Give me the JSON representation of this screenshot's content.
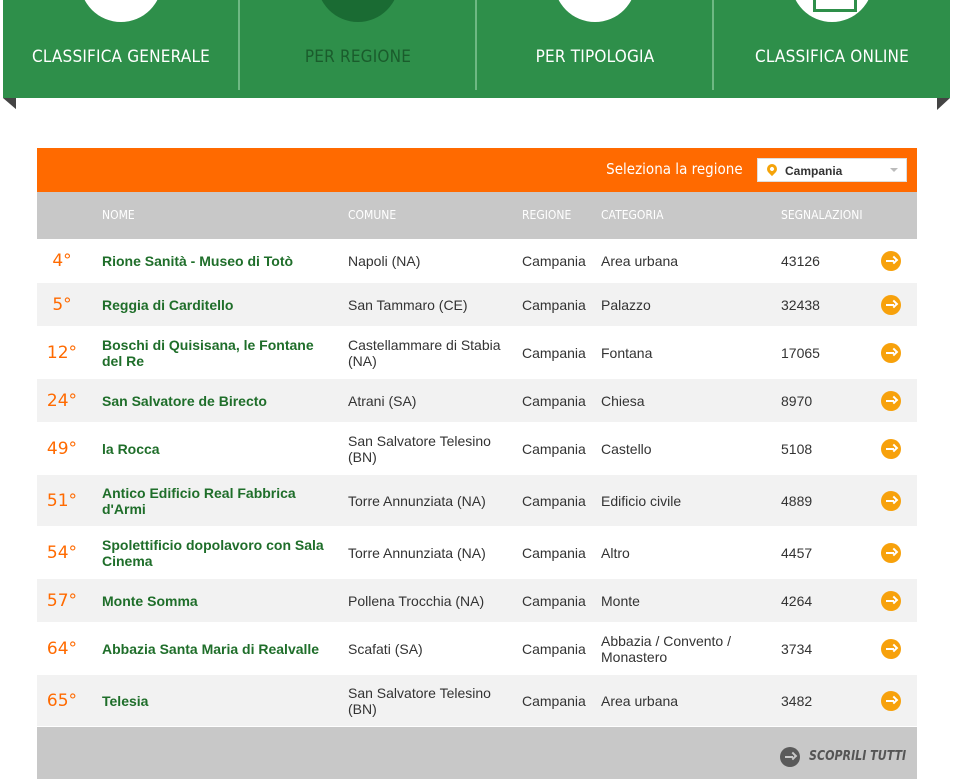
{
  "tabs": [
    {
      "label": "CLASSIFICA GENERALE",
      "active": false
    },
    {
      "label": "PER REGIONE",
      "active": true
    },
    {
      "label": "PER TIPOLOGIA",
      "active": false
    },
    {
      "label": "CLASSIFICA ONLINE",
      "active": false
    }
  ],
  "region_filter": {
    "label": "Seleziona la regione",
    "selected": "Campania",
    "icon": "map-pin-icon"
  },
  "table": {
    "headers": {
      "nome": "NOME",
      "comune": "COMUNE",
      "regione": "REGIONE",
      "categoria": "CATEGORIA",
      "segnalazioni": "SEGNALAZIONI"
    },
    "rows": [
      {
        "rank": "4°",
        "nome": "Rione Sanità - Museo di Totò",
        "comune": "Napoli (NA)",
        "regione": "Campania",
        "categoria": "Area urbana",
        "segnalazioni": "43126"
      },
      {
        "rank": "5°",
        "nome": "Reggia di Carditello",
        "comune": "San Tammaro (CE)",
        "regione": "Campania",
        "categoria": "Palazzo",
        "segnalazioni": "32438"
      },
      {
        "rank": "12°",
        "nome": "Boschi di Quisisana, le Fontane del Re",
        "comune": "Castellammare di Stabia (NA)",
        "regione": "Campania",
        "categoria": "Fontana",
        "segnalazioni": "17065"
      },
      {
        "rank": "24°",
        "nome": "San Salvatore de Birecto",
        "comune": "Atrani (SA)",
        "regione": "Campania",
        "categoria": "Chiesa",
        "segnalazioni": "8970"
      },
      {
        "rank": "49°",
        "nome": "la Rocca",
        "comune": "San Salvatore Telesino (BN)",
        "regione": "Campania",
        "categoria": "Castello",
        "segnalazioni": "5108"
      },
      {
        "rank": "51°",
        "nome": "Antico Edificio Real Fabbrica d'Armi",
        "comune": "Torre Annunziata (NA)",
        "regione": "Campania",
        "categoria": "Edificio civile",
        "segnalazioni": "4889"
      },
      {
        "rank": "54°",
        "nome": "Spolettificio dopolavoro con Sala Cinema",
        "comune": "Torre Annunziata (NA)",
        "regione": "Campania",
        "categoria": "Altro",
        "segnalazioni": "4457"
      },
      {
        "rank": "57°",
        "nome": "Monte Somma",
        "comune": "Pollena Trocchia (NA)",
        "regione": "Campania",
        "categoria": "Monte",
        "segnalazioni": "4264"
      },
      {
        "rank": "64°",
        "nome": "Abbazia Santa Maria di Realvalle",
        "comune": "Scafati (SA)",
        "regione": "Campania",
        "categoria": "Abbazia / Convento / Monastero",
        "segnalazioni": "3734"
      },
      {
        "rank": "65°",
        "nome": "Telesia",
        "comune": "San Salvatore Telesino (BN)",
        "regione": "Campania",
        "categoria": "Area urbana",
        "segnalazioni": "3482"
      }
    ]
  },
  "footer": {
    "more_label": "SCOPRILI TUTTI"
  },
  "colors": {
    "green": "#2e8f4a",
    "orange": "#ff6a00",
    "arrow": "#f7a10b",
    "header_gray": "#c8c8c8"
  }
}
